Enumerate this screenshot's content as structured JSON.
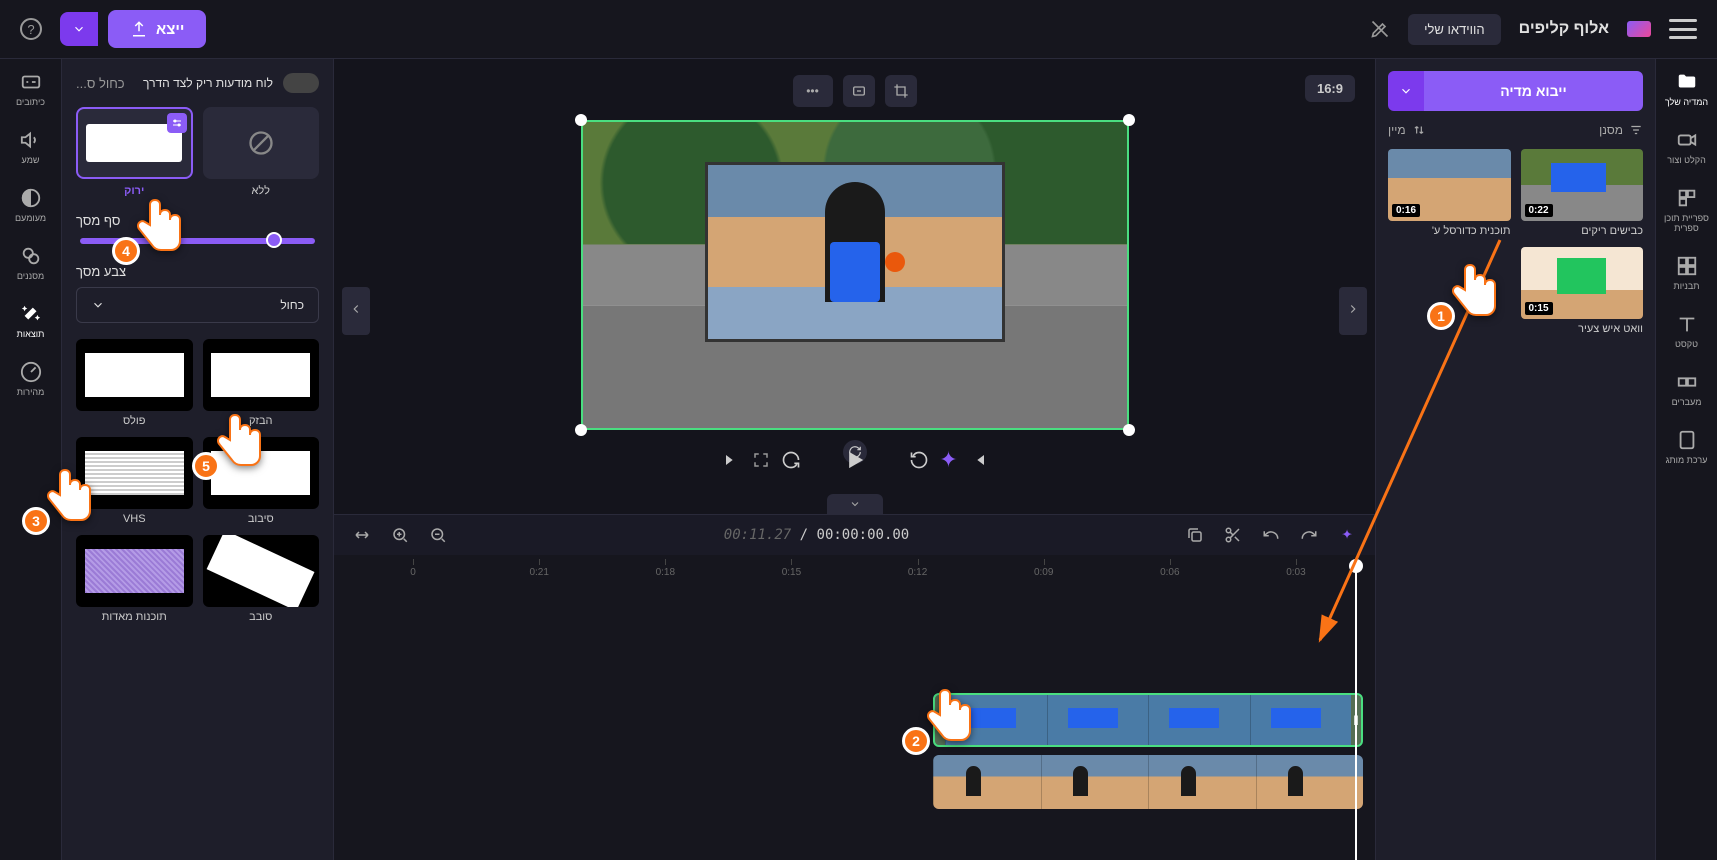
{
  "topbar": {
    "app_title": "אלוף קליפים",
    "presets_label": "הווידאו שלי",
    "export_label": "ייצא",
    "help_glyph": "?"
  },
  "right_rail": {
    "my_media": "המדיה שלך",
    "record": "הקלט וצור",
    "library": "ספריית תוכן ספרית",
    "templates": "תבניות",
    "text": "טקסט",
    "transitions": "מעברים",
    "brand": "ערכת מותג"
  },
  "media_panel": {
    "import_label": "ייבוא מדיה",
    "filter_label": "מסנן",
    "sort_label": "מיין",
    "items": [
      {
        "duration": "0:22",
        "label": "כבישים ריקים"
      },
      {
        "duration": "0:16",
        "label": "תוכנית כדורסל ע'"
      },
      {
        "duration": "0:15",
        "label": "וואט איש צעיר"
      }
    ]
  },
  "preview": {
    "aspect_label": "16:9"
  },
  "timeline": {
    "current": "00:00:00.00",
    "duration": "00:11.27",
    "ticks": [
      "0:03",
      "0:06",
      "0:09",
      "0:12",
      "0:15",
      "0:18",
      "0:21",
      "0"
    ]
  },
  "left_rail": {
    "captions": "כיתובים",
    "audio": "שמע",
    "fade": "מעומעם",
    "filters": "מסננים",
    "effects": "תוצאות",
    "speed": "מהירות"
  },
  "effects_panel": {
    "header_title": "לוח מודעות ריק לצד הדרך",
    "header_link": "כחול ס...",
    "tile_none": "ללא",
    "tile_green": "ירוק",
    "threshold_label": "סף מסך",
    "color_label": "צבע מסך",
    "color_value": "כחול",
    "effects": [
      {
        "label": "הבזק"
      },
      {
        "label": "פולס"
      },
      {
        "label": "סיבוב"
      },
      {
        "label": "VHS"
      },
      {
        "label": "סובב"
      },
      {
        "label": "תוכנות מאדות"
      }
    ]
  },
  "callouts": {
    "n1": "1",
    "n2": "2",
    "n3": "3",
    "n4": "4",
    "n5": "5"
  }
}
